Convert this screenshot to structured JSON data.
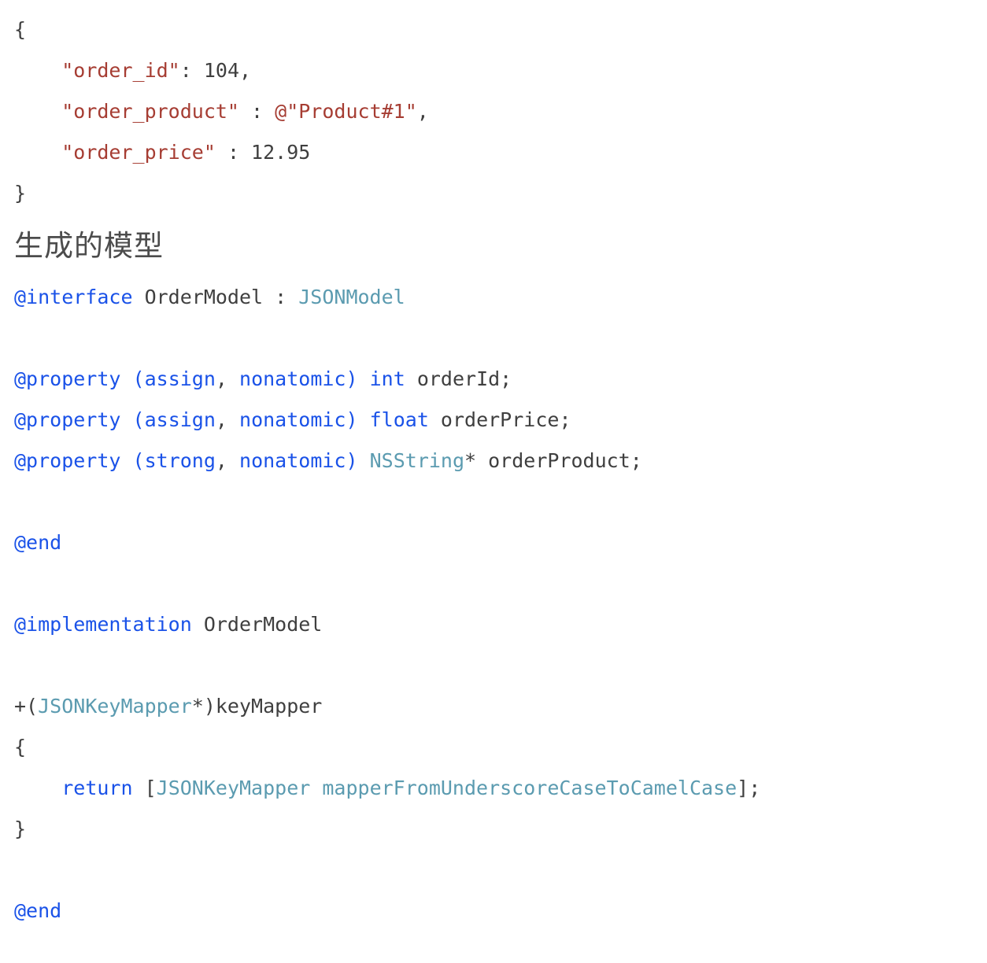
{
  "document": {
    "heading": "生成的模型",
    "background_color": "#ffffff",
    "colors": {
      "text": "#3f3f3f",
      "string": "#a63d33",
      "keyword": "#1a52e8",
      "type": "#5b9bb0",
      "heading": "#4c4c4c"
    }
  },
  "json_sample": {
    "lines": [
      {
        "indent": 0,
        "tokens": [
          {
            "text": "{",
            "kind": "punct"
          }
        ]
      },
      {
        "indent": 1,
        "tokens": [
          {
            "text": "\"order_id\"",
            "kind": "string"
          },
          {
            "text": ": ",
            "kind": "punct"
          },
          {
            "text": "104",
            "kind": "number"
          },
          {
            "text": ",",
            "kind": "punct"
          }
        ]
      },
      {
        "indent": 1,
        "tokens": [
          {
            "text": "\"order_product\"",
            "kind": "string"
          },
          {
            "text": " : ",
            "kind": "punct"
          },
          {
            "text": "@\"Product#1\"",
            "kind": "string"
          },
          {
            "text": ",",
            "kind": "punct"
          }
        ]
      },
      {
        "indent": 1,
        "tokens": [
          {
            "text": "\"order_price\"",
            "kind": "string"
          },
          {
            "text": " : ",
            "kind": "punct"
          },
          {
            "text": "12.95",
            "kind": "number"
          }
        ]
      },
      {
        "indent": 0,
        "tokens": [
          {
            "text": "}",
            "kind": "punct"
          }
        ]
      }
    ],
    "raw": "{\n    \"order_id\": 104,\n    \"order_product\" : @\"Product#1\",\n    \"order_price\" : 12.95\n}"
  },
  "objc_sample": {
    "lines": [
      {
        "indent": 0,
        "tokens": [
          {
            "text": "@interface",
            "kind": "keyword"
          },
          {
            "text": " OrderModel : ",
            "kind": "plain"
          },
          {
            "text": "JSONModel",
            "kind": "type"
          }
        ]
      },
      {
        "indent": 0,
        "tokens": []
      },
      {
        "indent": 0,
        "tokens": [
          {
            "text": "@property",
            "kind": "keyword"
          },
          {
            "text": " ",
            "kind": "plain"
          },
          {
            "text": "(",
            "kind": "keyword"
          },
          {
            "text": "assign",
            "kind": "keyword"
          },
          {
            "text": ", ",
            "kind": "punct"
          },
          {
            "text": "nonatomic",
            "kind": "keyword"
          },
          {
            "text": ")",
            "kind": "keyword"
          },
          {
            "text": " ",
            "kind": "plain"
          },
          {
            "text": "int",
            "kind": "keyword"
          },
          {
            "text": " orderId;",
            "kind": "plain"
          }
        ]
      },
      {
        "indent": 0,
        "tokens": [
          {
            "text": "@property",
            "kind": "keyword"
          },
          {
            "text": " ",
            "kind": "plain"
          },
          {
            "text": "(",
            "kind": "keyword"
          },
          {
            "text": "assign",
            "kind": "keyword"
          },
          {
            "text": ", ",
            "kind": "punct"
          },
          {
            "text": "nonatomic",
            "kind": "keyword"
          },
          {
            "text": ")",
            "kind": "keyword"
          },
          {
            "text": " ",
            "kind": "plain"
          },
          {
            "text": "float",
            "kind": "keyword"
          },
          {
            "text": " orderPrice;",
            "kind": "plain"
          }
        ]
      },
      {
        "indent": 0,
        "tokens": [
          {
            "text": "@property",
            "kind": "keyword"
          },
          {
            "text": " ",
            "kind": "plain"
          },
          {
            "text": "(",
            "kind": "keyword"
          },
          {
            "text": "strong",
            "kind": "keyword"
          },
          {
            "text": ", ",
            "kind": "punct"
          },
          {
            "text": "nonatomic",
            "kind": "keyword"
          },
          {
            "text": ")",
            "kind": "keyword"
          },
          {
            "text": " ",
            "kind": "plain"
          },
          {
            "text": "NSString",
            "kind": "type"
          },
          {
            "text": "* orderProduct;",
            "kind": "plain"
          }
        ]
      },
      {
        "indent": 0,
        "tokens": []
      },
      {
        "indent": 0,
        "tokens": [
          {
            "text": "@end",
            "kind": "keyword"
          }
        ]
      },
      {
        "indent": 0,
        "tokens": []
      },
      {
        "indent": 0,
        "tokens": [
          {
            "text": "@implementation",
            "kind": "keyword"
          },
          {
            "text": " OrderModel",
            "kind": "plain"
          }
        ]
      },
      {
        "indent": 0,
        "tokens": []
      },
      {
        "indent": 0,
        "tokens": [
          {
            "text": "+(",
            "kind": "plain"
          },
          {
            "text": "JSONKeyMapper",
            "kind": "type"
          },
          {
            "text": "*)keyMapper",
            "kind": "plain"
          }
        ]
      },
      {
        "indent": 0,
        "tokens": [
          {
            "text": "{",
            "kind": "plain"
          }
        ]
      },
      {
        "indent": 1,
        "tokens": [
          {
            "text": "return",
            "kind": "keyword"
          },
          {
            "text": " [",
            "kind": "plain"
          },
          {
            "text": "JSONKeyMapper mapperFromUnderscoreCaseToCamelCase",
            "kind": "type"
          },
          {
            "text": "];",
            "kind": "plain"
          }
        ]
      },
      {
        "indent": 0,
        "tokens": [
          {
            "text": "}",
            "kind": "plain"
          }
        ]
      },
      {
        "indent": 0,
        "tokens": []
      },
      {
        "indent": 0,
        "tokens": [
          {
            "text": "@end",
            "kind": "keyword"
          }
        ]
      }
    ],
    "raw": "@interface OrderModel : JSONModel\n\n@property (assign, nonatomic) int orderId;\n@property (assign, nonatomic) float orderPrice;\n@property (strong, nonatomic) NSString* orderProduct;\n\n@end\n\n@implementation OrderModel\n\n+(JSONKeyMapper*)keyMapper\n{\n    return [JSONKeyMapper mapperFromUnderscoreCaseToCamelCase];\n}\n\n@end"
  }
}
